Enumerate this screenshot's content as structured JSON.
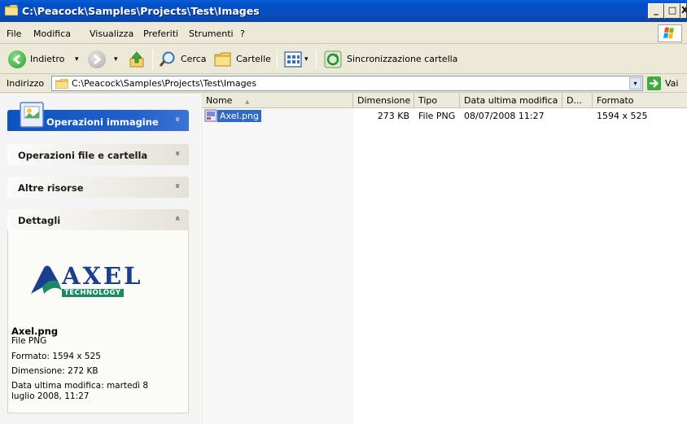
{
  "window": {
    "title": "C:\\Peacock\\Samples\\Projects\\Test\\Images",
    "minimize_label": "_",
    "maximize_label": "□",
    "close_label": "X"
  },
  "menubar": {
    "items": [
      {
        "label": "File"
      },
      {
        "label": "Modifica"
      },
      {
        "label": "Visualizza"
      },
      {
        "label": "Preferiti"
      },
      {
        "label": "Strumenti"
      },
      {
        "label": "?"
      }
    ]
  },
  "toolbar": {
    "back_label": "Indietro",
    "search_label": "Cerca",
    "folders_label": "Cartelle",
    "sync_label": "Sincronizzazione cartella",
    "dropdown_glyph": "▾"
  },
  "addressbar": {
    "label": "Indirizzo",
    "value": "C:\\Peacock\\Samples\\Projects\\Test\\Images",
    "go_label": "Vai"
  },
  "taskpane": {
    "panels": [
      {
        "label": "Operazioni immagine",
        "chevron": "»"
      },
      {
        "label": "Operazioni file e cartella",
        "chevron": "»"
      },
      {
        "label": "Altre risorse",
        "chevron": "»"
      },
      {
        "label": "Dettagli",
        "chevron": "«"
      }
    ],
    "details": {
      "logo_text": "AXEL",
      "logo_subtext": "TECHNOLOGY",
      "file_name": "Axel.png",
      "file_type": "File PNG",
      "format": "Formato: 1594 x 525",
      "size": "Dimensione: 272 KB",
      "modified_line1": "Data ultima modifica: martedì 8",
      "modified_line2": "luglio 2008, 11:27"
    }
  },
  "filelist": {
    "columns": [
      {
        "label": "Nome"
      },
      {
        "label": "Dimensione"
      },
      {
        "label": "Tipo"
      },
      {
        "label": "Data ultima modifica"
      },
      {
        "label": "D..."
      },
      {
        "label": "Formato"
      }
    ],
    "sort_indicator": "▲",
    "rows": [
      {
        "name": "Axel.png",
        "size": "273 KB",
        "type": "File PNG",
        "modified": "08/07/2008 11:27",
        "format": "1594 x 525"
      }
    ]
  },
  "colors": {
    "titlebar": "#0a4ec0",
    "selection": "#316ac5",
    "panel_blue": "#0c53c1",
    "logo_blue": "#1b3f8f",
    "logo_green": "#1a8a62"
  }
}
